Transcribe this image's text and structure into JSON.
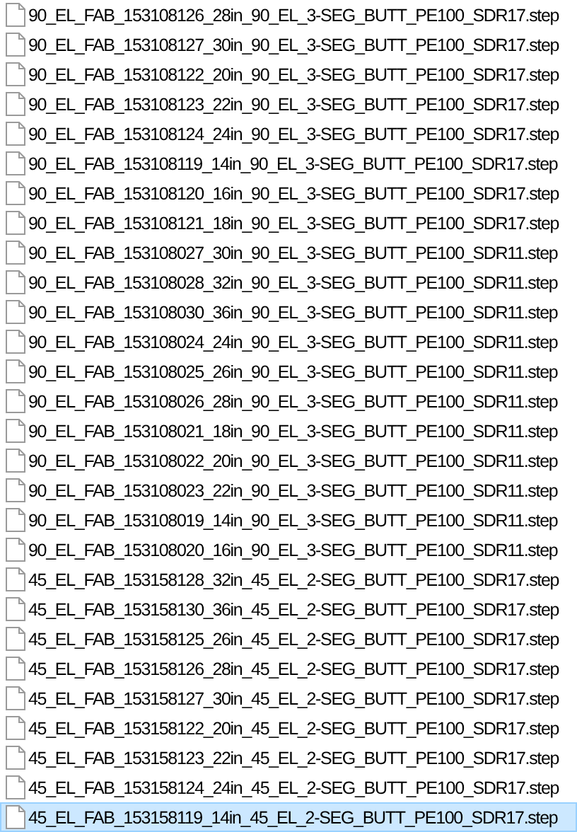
{
  "files": [
    {
      "name": "90_EL_FAB_153108126_28in_90_EL_3-SEG_BUTT_PE100_SDR17.step",
      "selected": false
    },
    {
      "name": "90_EL_FAB_153108127_30in_90_EL_3-SEG_BUTT_PE100_SDR17.step",
      "selected": false
    },
    {
      "name": "90_EL_FAB_153108122_20in_90_EL_3-SEG_BUTT_PE100_SDR17.step",
      "selected": false
    },
    {
      "name": "90_EL_FAB_153108123_22in_90_EL_3-SEG_BUTT_PE100_SDR17.step",
      "selected": false
    },
    {
      "name": "90_EL_FAB_153108124_24in_90_EL_3-SEG_BUTT_PE100_SDR17.step",
      "selected": false
    },
    {
      "name": "90_EL_FAB_153108119_14in_90_EL_3-SEG_BUTT_PE100_SDR17.step",
      "selected": false
    },
    {
      "name": "90_EL_FAB_153108120_16in_90_EL_3-SEG_BUTT_PE100_SDR17.step",
      "selected": false
    },
    {
      "name": "90_EL_FAB_153108121_18in_90_EL_3-SEG_BUTT_PE100_SDR17.step",
      "selected": false
    },
    {
      "name": "90_EL_FAB_153108027_30in_90_EL_3-SEG_BUTT_PE100_SDR11.step",
      "selected": false
    },
    {
      "name": "90_EL_FAB_153108028_32in_90_EL_3-SEG_BUTT_PE100_SDR11.step",
      "selected": false
    },
    {
      "name": "90_EL_FAB_153108030_36in_90_EL_3-SEG_BUTT_PE100_SDR11.step",
      "selected": false
    },
    {
      "name": "90_EL_FAB_153108024_24in_90_EL_3-SEG_BUTT_PE100_SDR11.step",
      "selected": false
    },
    {
      "name": "90_EL_FAB_153108025_26in_90_EL_3-SEG_BUTT_PE100_SDR11.step",
      "selected": false
    },
    {
      "name": "90_EL_FAB_153108026_28in_90_EL_3-SEG_BUTT_PE100_SDR11.step",
      "selected": false
    },
    {
      "name": "90_EL_FAB_153108021_18in_90_EL_3-SEG_BUTT_PE100_SDR11.step",
      "selected": false
    },
    {
      "name": "90_EL_FAB_153108022_20in_90_EL_3-SEG_BUTT_PE100_SDR11.step",
      "selected": false
    },
    {
      "name": "90_EL_FAB_153108023_22in_90_EL_3-SEG_BUTT_PE100_SDR11.step",
      "selected": false
    },
    {
      "name": "90_EL_FAB_153108019_14in_90_EL_3-SEG_BUTT_PE100_SDR11.step",
      "selected": false
    },
    {
      "name": "90_EL_FAB_153108020_16in_90_EL_3-SEG_BUTT_PE100_SDR11.step",
      "selected": false
    },
    {
      "name": "45_EL_FAB_153158128_32in_45_EL_2-SEG_BUTT_PE100_SDR17.step",
      "selected": false
    },
    {
      "name": "45_EL_FAB_153158130_36in_45_EL_2-SEG_BUTT_PE100_SDR17.step",
      "selected": false
    },
    {
      "name": "45_EL_FAB_153158125_26in_45_EL_2-SEG_BUTT_PE100_SDR17.step",
      "selected": false
    },
    {
      "name": "45_EL_FAB_153158126_28in_45_EL_2-SEG_BUTT_PE100_SDR17.step",
      "selected": false
    },
    {
      "name": "45_EL_FAB_153158127_30in_45_EL_2-SEG_BUTT_PE100_SDR17.step",
      "selected": false
    },
    {
      "name": "45_EL_FAB_153158122_20in_45_EL_2-SEG_BUTT_PE100_SDR17.step",
      "selected": false
    },
    {
      "name": "45_EL_FAB_153158123_22in_45_EL_2-SEG_BUTT_PE100_SDR17.step",
      "selected": false
    },
    {
      "name": "45_EL_FAB_153158124_24in_45_EL_2-SEG_BUTT_PE100_SDR17.step",
      "selected": false
    },
    {
      "name": "45_EL_FAB_153158119_14in_45_EL_2-SEG_BUTT_PE100_SDR17.step",
      "selected": true
    }
  ]
}
